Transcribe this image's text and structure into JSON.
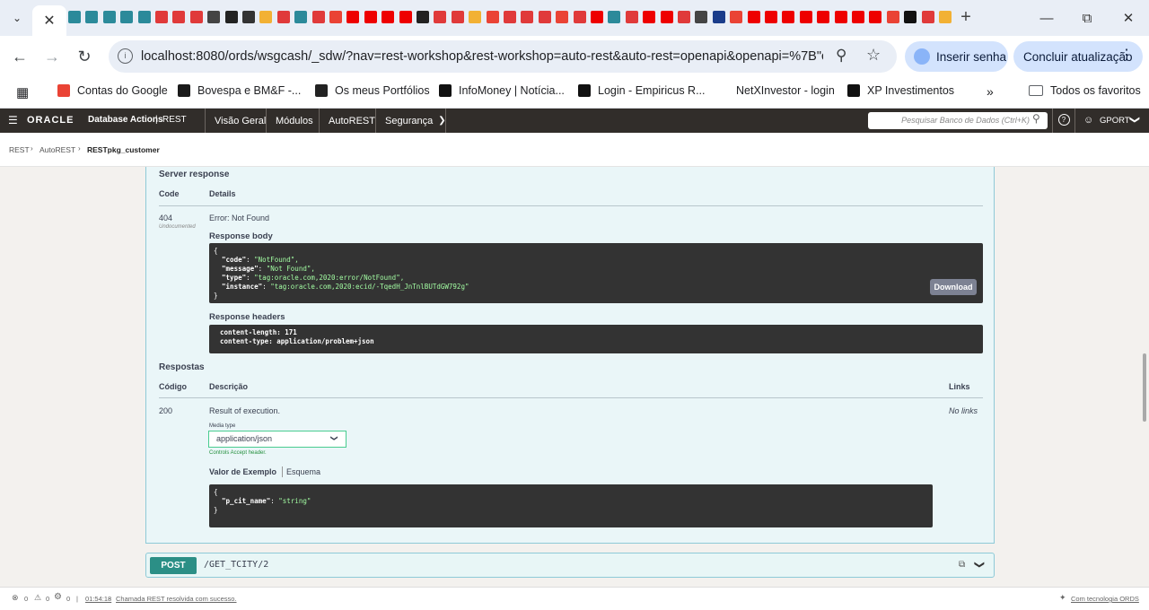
{
  "browser": {
    "new_tab_icon": "+",
    "url": "localhost:8080/ords/wsgcash/_sdw/?nav=rest-workshop&rest-workshop=auto-rest&auto-rest=openapi&openapi=%7B\"o...",
    "password_pill": "Inserir senha",
    "update_pill": "Concluir atualização"
  },
  "bookmarks": [
    {
      "label": "Contas do Google",
      "icon": "gmail-icon",
      "color": "#ea4335"
    },
    {
      "label": "Bovespa e BM&F -...",
      "icon": "chart-icon",
      "color": "#1a1a1a"
    },
    {
      "label": "Os meus Portfólios",
      "icon": "investing-icon",
      "color": "#222"
    },
    {
      "label": "InfoMoney | Notícia...",
      "icon": "im-icon",
      "color": "#111"
    },
    {
      "label": "Login - Empiricus R...",
      "icon": "empiricus-icon",
      "color": "#111"
    },
    {
      "label": "NetXInvestor - login",
      "icon": "",
      "color": ""
    },
    {
      "label": "XP Investimentos",
      "icon": "xp-icon",
      "color": "#111"
    }
  ],
  "bookmarks_all": "Todos os favoritos",
  "oracle": {
    "brand": "ORACLE",
    "product": "Database Actions",
    "section": "REST",
    "nav": [
      "Visão Geral",
      "Módulos",
      "AutoREST",
      "Segurança"
    ],
    "search_placeholder": "Pesquisar Banco de Dados (Ctrl+K)",
    "user": "GPORT"
  },
  "breadcrumb": [
    "REST",
    "AutoREST",
    "RESTpkg_customer"
  ],
  "server_response": {
    "heading": "Server response",
    "col_code": "Code",
    "col_details": "Details",
    "code": "404",
    "undocumented": "Undocumented",
    "error": "Error: Not Found",
    "body_heading": "Response body",
    "body_open": "{",
    "body_close": "}",
    "body_lines": [
      {
        "key": "\"code\"",
        "value": "\"NotFound\","
      },
      {
        "key": "\"message\"",
        "value": "\"Not Found\","
      },
      {
        "key": "\"type\"",
        "value": "\"tag:oracle.com,2020:error/NotFound\","
      },
      {
        "key": "\"instance\"",
        "value": "\"tag:oracle.com,2020:ecid/-TqedH_JnTnlBUTdGW792g\""
      }
    ],
    "download": "Download",
    "headers_heading": "Response headers",
    "headers": [
      {
        "key": "content-length",
        "value": "171"
      },
      {
        "key": "content-type",
        "value": "application/problem+json"
      }
    ]
  },
  "responses": {
    "heading": "Respostas",
    "col_code": "Código",
    "col_desc": "Descrição",
    "col_links": "Links",
    "code": "200",
    "desc": "Result of execution.",
    "links": "No links",
    "media_label": "Media type",
    "media_value": "application/json",
    "media_hint": "Controls Accept header.",
    "tab_example": "Valor de Exemplo",
    "tab_schema": "Esquema",
    "example_open": "{",
    "example_key": "\"p_cit_name\"",
    "example_value": "\"string\"",
    "example_close": "}"
  },
  "post_op": {
    "method": "POST",
    "path": "/GET_TCITY/2"
  },
  "status": {
    "err_count": "0",
    "warn_count": "0",
    "settings_count": "0",
    "time": "01:54:18",
    "message": "Chamada REST resolvida com sucesso.",
    "powered": "Com tecnologia ORDS"
  }
}
